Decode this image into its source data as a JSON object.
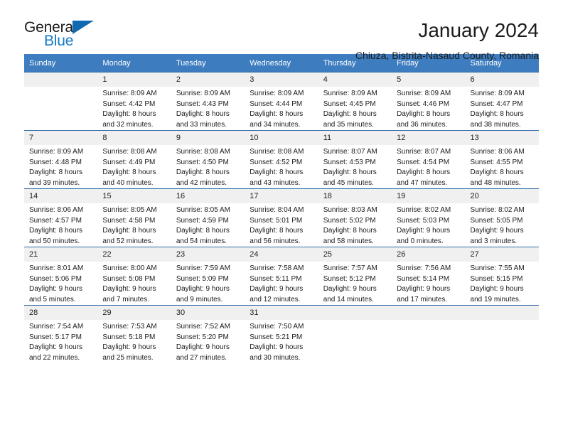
{
  "brand": {
    "name_part1": "General",
    "name_part2": "Blue",
    "triangle_icon": "triangle-icon",
    "accent_color": "#1479c4"
  },
  "header": {
    "title": "January 2024",
    "subtitle": "Chiuza, Bistrita-Nasaud County, Romania"
  },
  "calendar": {
    "header_bg": "#3d7cbf",
    "daynum_bg": "#f0f0f0",
    "weekdays": [
      "Sunday",
      "Monday",
      "Tuesday",
      "Wednesday",
      "Thursday",
      "Friday",
      "Saturday"
    ],
    "weeks": [
      [
        {
          "day": "",
          "sunrise": "",
          "sunset": "",
          "daylight_line1": "",
          "daylight_line2": ""
        },
        {
          "day": "1",
          "sunrise": "Sunrise: 8:09 AM",
          "sunset": "Sunset: 4:42 PM",
          "daylight_line1": "Daylight: 8 hours",
          "daylight_line2": "and 32 minutes."
        },
        {
          "day": "2",
          "sunrise": "Sunrise: 8:09 AM",
          "sunset": "Sunset: 4:43 PM",
          "daylight_line1": "Daylight: 8 hours",
          "daylight_line2": "and 33 minutes."
        },
        {
          "day": "3",
          "sunrise": "Sunrise: 8:09 AM",
          "sunset": "Sunset: 4:44 PM",
          "daylight_line1": "Daylight: 8 hours",
          "daylight_line2": "and 34 minutes."
        },
        {
          "day": "4",
          "sunrise": "Sunrise: 8:09 AM",
          "sunset": "Sunset: 4:45 PM",
          "daylight_line1": "Daylight: 8 hours",
          "daylight_line2": "and 35 minutes."
        },
        {
          "day": "5",
          "sunrise": "Sunrise: 8:09 AM",
          "sunset": "Sunset: 4:46 PM",
          "daylight_line1": "Daylight: 8 hours",
          "daylight_line2": "and 36 minutes."
        },
        {
          "day": "6",
          "sunrise": "Sunrise: 8:09 AM",
          "sunset": "Sunset: 4:47 PM",
          "daylight_line1": "Daylight: 8 hours",
          "daylight_line2": "and 38 minutes."
        }
      ],
      [
        {
          "day": "7",
          "sunrise": "Sunrise: 8:09 AM",
          "sunset": "Sunset: 4:48 PM",
          "daylight_line1": "Daylight: 8 hours",
          "daylight_line2": "and 39 minutes."
        },
        {
          "day": "8",
          "sunrise": "Sunrise: 8:08 AM",
          "sunset": "Sunset: 4:49 PM",
          "daylight_line1": "Daylight: 8 hours",
          "daylight_line2": "and 40 minutes."
        },
        {
          "day": "9",
          "sunrise": "Sunrise: 8:08 AM",
          "sunset": "Sunset: 4:50 PM",
          "daylight_line1": "Daylight: 8 hours",
          "daylight_line2": "and 42 minutes."
        },
        {
          "day": "10",
          "sunrise": "Sunrise: 8:08 AM",
          "sunset": "Sunset: 4:52 PM",
          "daylight_line1": "Daylight: 8 hours",
          "daylight_line2": "and 43 minutes."
        },
        {
          "day": "11",
          "sunrise": "Sunrise: 8:07 AM",
          "sunset": "Sunset: 4:53 PM",
          "daylight_line1": "Daylight: 8 hours",
          "daylight_line2": "and 45 minutes."
        },
        {
          "day": "12",
          "sunrise": "Sunrise: 8:07 AM",
          "sunset": "Sunset: 4:54 PM",
          "daylight_line1": "Daylight: 8 hours",
          "daylight_line2": "and 47 minutes."
        },
        {
          "day": "13",
          "sunrise": "Sunrise: 8:06 AM",
          "sunset": "Sunset: 4:55 PM",
          "daylight_line1": "Daylight: 8 hours",
          "daylight_line2": "and 48 minutes."
        }
      ],
      [
        {
          "day": "14",
          "sunrise": "Sunrise: 8:06 AM",
          "sunset": "Sunset: 4:57 PM",
          "daylight_line1": "Daylight: 8 hours",
          "daylight_line2": "and 50 minutes."
        },
        {
          "day": "15",
          "sunrise": "Sunrise: 8:05 AM",
          "sunset": "Sunset: 4:58 PM",
          "daylight_line1": "Daylight: 8 hours",
          "daylight_line2": "and 52 minutes."
        },
        {
          "day": "16",
          "sunrise": "Sunrise: 8:05 AM",
          "sunset": "Sunset: 4:59 PM",
          "daylight_line1": "Daylight: 8 hours",
          "daylight_line2": "and 54 minutes."
        },
        {
          "day": "17",
          "sunrise": "Sunrise: 8:04 AM",
          "sunset": "Sunset: 5:01 PM",
          "daylight_line1": "Daylight: 8 hours",
          "daylight_line2": "and 56 minutes."
        },
        {
          "day": "18",
          "sunrise": "Sunrise: 8:03 AM",
          "sunset": "Sunset: 5:02 PM",
          "daylight_line1": "Daylight: 8 hours",
          "daylight_line2": "and 58 minutes."
        },
        {
          "day": "19",
          "sunrise": "Sunrise: 8:02 AM",
          "sunset": "Sunset: 5:03 PM",
          "daylight_line1": "Daylight: 9 hours",
          "daylight_line2": "and 0 minutes."
        },
        {
          "day": "20",
          "sunrise": "Sunrise: 8:02 AM",
          "sunset": "Sunset: 5:05 PM",
          "daylight_line1": "Daylight: 9 hours",
          "daylight_line2": "and 3 minutes."
        }
      ],
      [
        {
          "day": "21",
          "sunrise": "Sunrise: 8:01 AM",
          "sunset": "Sunset: 5:06 PM",
          "daylight_line1": "Daylight: 9 hours",
          "daylight_line2": "and 5 minutes."
        },
        {
          "day": "22",
          "sunrise": "Sunrise: 8:00 AM",
          "sunset": "Sunset: 5:08 PM",
          "daylight_line1": "Daylight: 9 hours",
          "daylight_line2": "and 7 minutes."
        },
        {
          "day": "23",
          "sunrise": "Sunrise: 7:59 AM",
          "sunset": "Sunset: 5:09 PM",
          "daylight_line1": "Daylight: 9 hours",
          "daylight_line2": "and 9 minutes."
        },
        {
          "day": "24",
          "sunrise": "Sunrise: 7:58 AM",
          "sunset": "Sunset: 5:11 PM",
          "daylight_line1": "Daylight: 9 hours",
          "daylight_line2": "and 12 minutes."
        },
        {
          "day": "25",
          "sunrise": "Sunrise: 7:57 AM",
          "sunset": "Sunset: 5:12 PM",
          "daylight_line1": "Daylight: 9 hours",
          "daylight_line2": "and 14 minutes."
        },
        {
          "day": "26",
          "sunrise": "Sunrise: 7:56 AM",
          "sunset": "Sunset: 5:14 PM",
          "daylight_line1": "Daylight: 9 hours",
          "daylight_line2": "and 17 minutes."
        },
        {
          "day": "27",
          "sunrise": "Sunrise: 7:55 AM",
          "sunset": "Sunset: 5:15 PM",
          "daylight_line1": "Daylight: 9 hours",
          "daylight_line2": "and 19 minutes."
        }
      ],
      [
        {
          "day": "28",
          "sunrise": "Sunrise: 7:54 AM",
          "sunset": "Sunset: 5:17 PM",
          "daylight_line1": "Daylight: 9 hours",
          "daylight_line2": "and 22 minutes."
        },
        {
          "day": "29",
          "sunrise": "Sunrise: 7:53 AM",
          "sunset": "Sunset: 5:18 PM",
          "daylight_line1": "Daylight: 9 hours",
          "daylight_line2": "and 25 minutes."
        },
        {
          "day": "30",
          "sunrise": "Sunrise: 7:52 AM",
          "sunset": "Sunset: 5:20 PM",
          "daylight_line1": "Daylight: 9 hours",
          "daylight_line2": "and 27 minutes."
        },
        {
          "day": "31",
          "sunrise": "Sunrise: 7:50 AM",
          "sunset": "Sunset: 5:21 PM",
          "daylight_line1": "Daylight: 9 hours",
          "daylight_line2": "and 30 minutes."
        },
        {
          "day": "",
          "sunrise": "",
          "sunset": "",
          "daylight_line1": "",
          "daylight_line2": ""
        },
        {
          "day": "",
          "sunrise": "",
          "sunset": "",
          "daylight_line1": "",
          "daylight_line2": ""
        },
        {
          "day": "",
          "sunrise": "",
          "sunset": "",
          "daylight_line1": "",
          "daylight_line2": ""
        }
      ]
    ]
  }
}
